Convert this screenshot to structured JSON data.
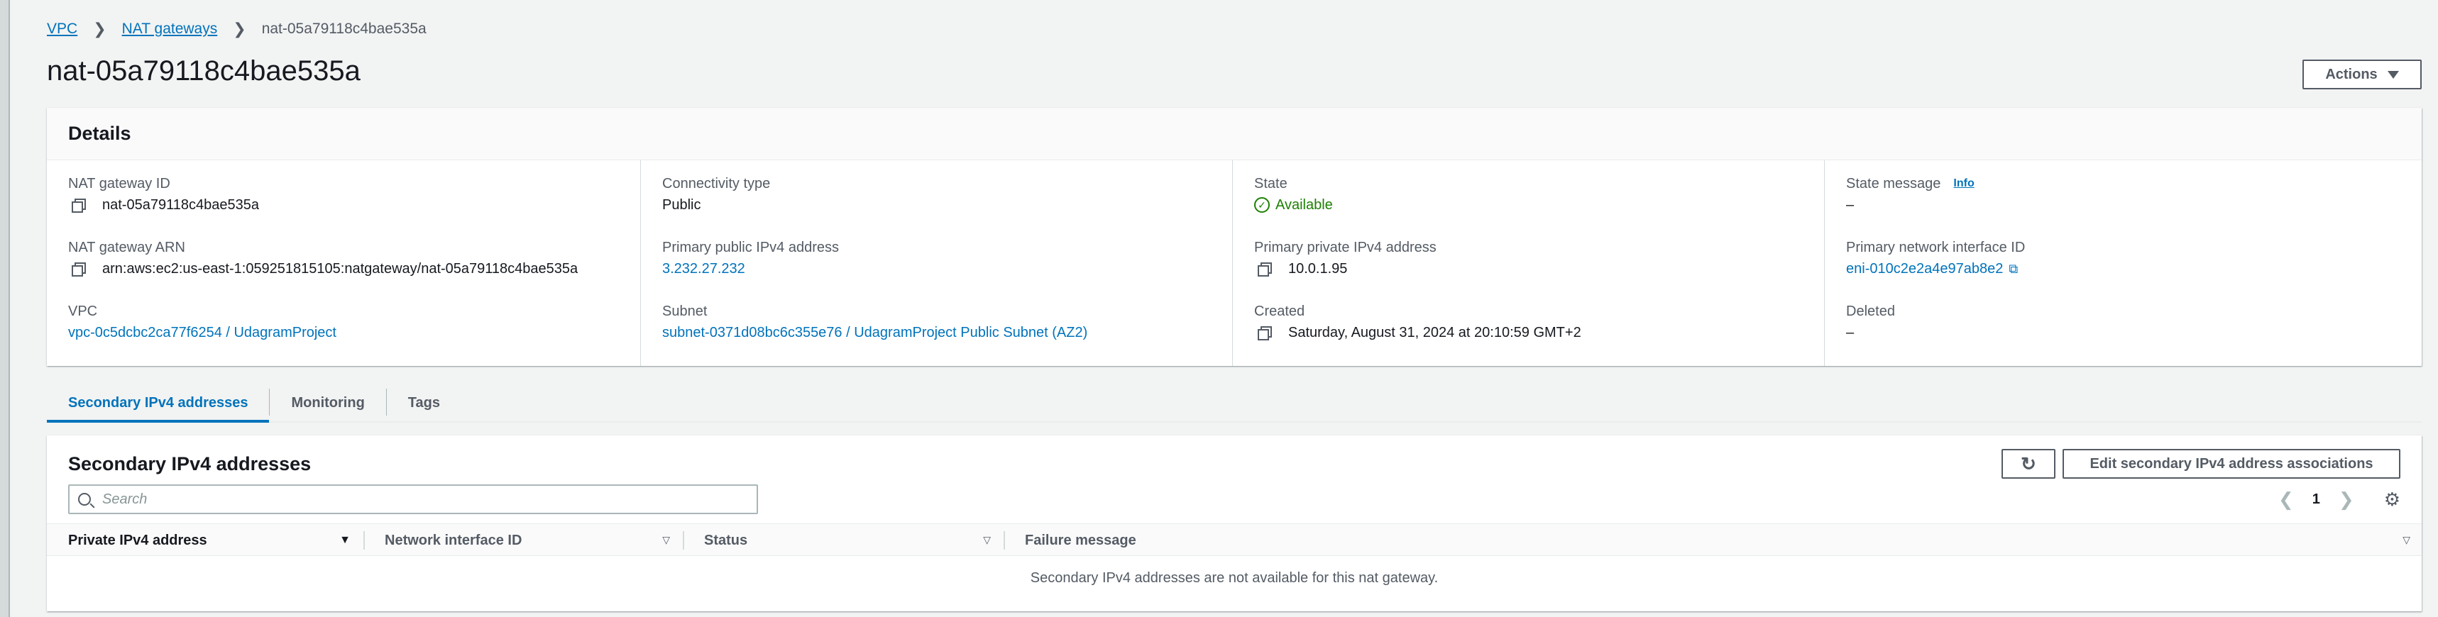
{
  "breadcrumb": {
    "root": "VPC",
    "parent": "NAT gateways",
    "current": "nat-05a79118c4bae535a"
  },
  "page_title": "nat-05a79118c4bae535a",
  "actions_label": "Actions",
  "details": {
    "title": "Details",
    "nat_gateway_id_label": "NAT gateway ID",
    "nat_gateway_id": "nat-05a79118c4bae535a",
    "nat_gateway_arn_label": "NAT gateway ARN",
    "nat_gateway_arn": "arn:aws:ec2:us-east-1:059251815105:natgateway/nat-05a79118c4bae535a",
    "vpc_label": "VPC",
    "vpc_value": "vpc-0c5dcbc2ca77f6254 / UdagramProject",
    "connectivity_type_label": "Connectivity type",
    "connectivity_type": "Public",
    "primary_public_ip_label": "Primary public IPv4 address",
    "primary_public_ip": "3.232.27.232",
    "subnet_label": "Subnet",
    "subnet_value": "subnet-0371d08bc6c355e76 / UdagramProject Public Subnet (AZ2)",
    "state_label": "State",
    "state_value": "Available",
    "primary_private_ip_label": "Primary private IPv4 address",
    "primary_private_ip": "10.0.1.95",
    "created_label": "Created",
    "created_value": "Saturday, August 31, 2024 at 20:10:59 GMT+2",
    "state_message_label": "State message",
    "info_label": "Info",
    "state_message_value": "–",
    "primary_eni_label": "Primary network interface ID",
    "primary_eni": "eni-010c2e2a4e97ab8e2",
    "deleted_label": "Deleted",
    "deleted_value": "–"
  },
  "tabs": [
    {
      "label": "Secondary IPv4 addresses",
      "active": true
    },
    {
      "label": "Monitoring",
      "active": false
    },
    {
      "label": "Tags",
      "active": false
    }
  ],
  "secondary": {
    "title": "Secondary IPv4 addresses",
    "edit_button_label": "Edit secondary IPv4 address associations",
    "search_placeholder": "Search",
    "page_number": "1",
    "columns": [
      "Private IPv4 address",
      "Network interface ID",
      "Status",
      "Failure message"
    ],
    "empty_message": "Secondary IPv4 addresses are not available for this nat gateway."
  },
  "colors": {
    "link": "#0073bb",
    "success": "#1d8102",
    "text": "#16191f",
    "muted": "#545b64",
    "background": "#f2f3f3"
  },
  "icons": [
    "copy-icon",
    "check-circle-icon",
    "external-link-icon",
    "refresh-icon",
    "search-icon",
    "chevron-left-icon",
    "chevron-right-icon",
    "gear-icon",
    "caret-down-icon"
  ]
}
